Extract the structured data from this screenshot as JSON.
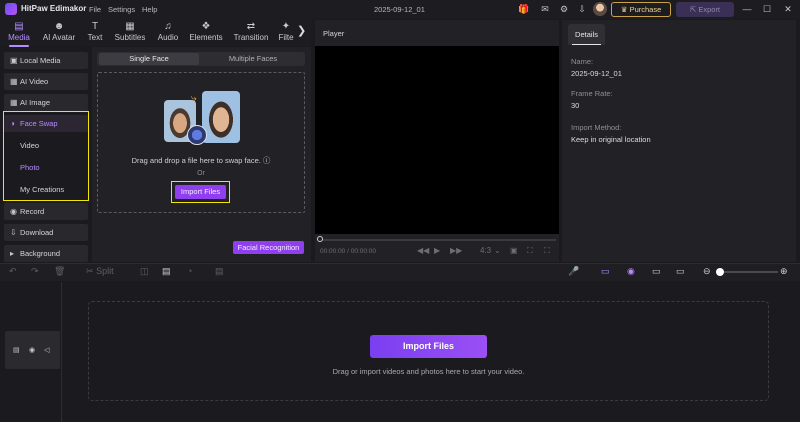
{
  "app": {
    "name": "HitPaw Edimakor",
    "project_title": "2025-09-12_01"
  },
  "menu": [
    "File",
    "Settings",
    "Help"
  ],
  "titlebar": {
    "purchase_label": "Purchase",
    "export_label": "Export",
    "icons": [
      "gift-icon",
      "chat-icon",
      "gear-icon",
      "download-icon",
      "avatar"
    ],
    "window_controls": [
      "minimize-icon",
      "maximize-icon",
      "close-icon"
    ]
  },
  "toolbar": {
    "tabs": [
      {
        "label": "Media",
        "icon": "media-icon",
        "active": true
      },
      {
        "label": "AI Avatar",
        "icon": "ai-avatar-icon",
        "active": false
      },
      {
        "label": "Text",
        "icon": "text-icon",
        "active": false
      },
      {
        "label": "Subtitles",
        "icon": "subtitles-icon",
        "active": false
      },
      {
        "label": "Audio",
        "icon": "audio-icon",
        "active": false
      },
      {
        "label": "Elements",
        "icon": "elements-icon",
        "active": false
      },
      {
        "label": "Transition",
        "icon": "transition-icon",
        "active": false
      },
      {
        "label": "Filte",
        "icon": "filter-icon",
        "active": false
      }
    ]
  },
  "sidebar": {
    "items": [
      {
        "label": "Local Media",
        "icon": "folder-icon"
      },
      {
        "label": "AI Video",
        "icon": "ai-video-icon"
      },
      {
        "label": "AI Image",
        "icon": "ai-image-icon"
      },
      {
        "label": "Face Swap",
        "icon": "face-swap-icon"
      },
      {
        "label": "Record",
        "icon": "record-icon"
      },
      {
        "label": "Download",
        "icon": "download-icon"
      },
      {
        "label": "Background",
        "icon": "chevron-right-icon"
      }
    ],
    "face_swap_sub": [
      "Video",
      "Photo",
      "My Creations"
    ],
    "active_sub": "Photo"
  },
  "face_swap_panel": {
    "segments": [
      "Single Face",
      "Multiple Faces"
    ],
    "active_segment": "Single Face",
    "drop_text": "Drag and drop a file here to swap face.",
    "or_text": "Or",
    "import_label": "Import Files",
    "facial_recognition_label": "Facial Recognition"
  },
  "player": {
    "title": "Player",
    "time": "00:00:00 / 00:00:00",
    "aspect": "4:3"
  },
  "details": {
    "tab": "Details",
    "fields": [
      {
        "label": "Name:",
        "value": "2025-09-12_01"
      },
      {
        "label": "Frame Rate:",
        "value": "30"
      },
      {
        "label": "Import Method:",
        "value": "Keep in original location"
      }
    ]
  },
  "timeline_toolbar": {
    "split_label": "Split",
    "zoom_level": 0
  },
  "timeline": {
    "import_label": "Import Files",
    "hint": "Drag or import videos and photos here to start your video."
  },
  "colors": {
    "accent": "#b78cff",
    "primary_button": "#8f3ff0",
    "highlight_box": "#f2e600",
    "purchase_gold": "#f1d38b"
  }
}
